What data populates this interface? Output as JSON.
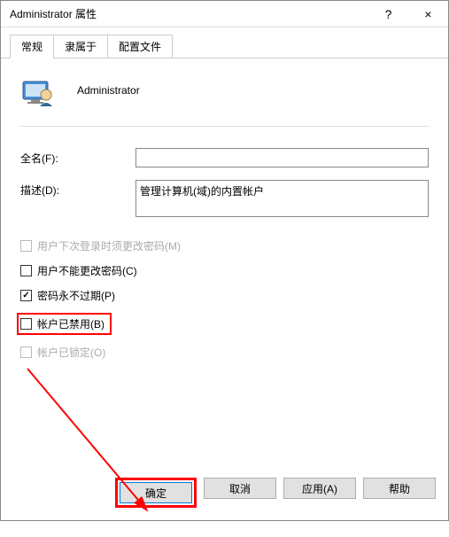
{
  "title": "Administrator 属性",
  "titlebar": {
    "help": "?",
    "close": "×"
  },
  "tabs": {
    "general": "常规",
    "memberof": "隶属于",
    "profile": "配置文件"
  },
  "user": {
    "name": "Administrator"
  },
  "form": {
    "fullname_label": "全名(F):",
    "fullname_value": "",
    "desc_label": "描述(D):",
    "desc_value": "管理计算机(域)的内置帐户"
  },
  "checks": {
    "mustchange": "用户下次登录时须更改密码(M)",
    "cannotchange": "用户不能更改密码(C)",
    "neverexpire": "密码永不过期(P)",
    "disabled": "帐户已禁用(B)",
    "locked": "帐户已锁定(O)"
  },
  "buttons": {
    "ok": "确定",
    "cancel": "取消",
    "apply": "应用(A)",
    "help": "帮助"
  }
}
